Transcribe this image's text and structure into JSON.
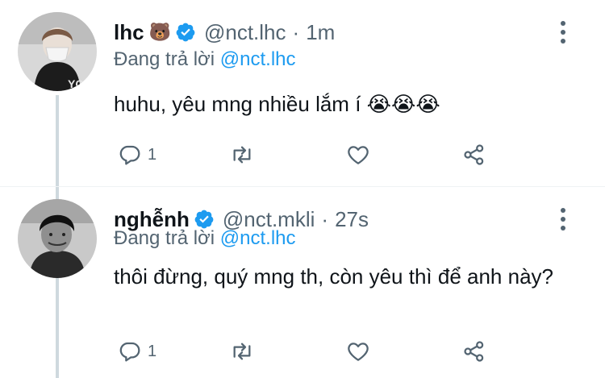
{
  "colors": {
    "link": "#1d9bf0",
    "muted": "#536471",
    "text": "#0f1419",
    "thread_line": "#cfd9de"
  },
  "tweets": [
    {
      "display_name": "lhc",
      "name_emoji": "🐻",
      "verified_icon": "verified-badge-icon",
      "handle": "@nct.lhc",
      "separator": "·",
      "time": "1m",
      "replying_prefix": "Đang trả lời",
      "replying_to": "@nct.lhc",
      "text": "huhu, yêu mng nhiều lắm í 😭😭😭",
      "reply_count": "1",
      "icons": [
        "reply-icon",
        "retweet-icon",
        "like-icon",
        "share-icon",
        "more-options-icon"
      ]
    },
    {
      "display_name": "nghễnh",
      "verified_icon": "verified-badge-icon",
      "handle": "@nct.mkli",
      "separator": "·",
      "time": "27s",
      "replying_prefix": "Đang trả lời",
      "replying_to": "@nct.lhc",
      "text": "thôi đừng, quý mng th, còn yêu thì để anh này?",
      "reply_count": "1",
      "icons": [
        "reply-icon",
        "retweet-icon",
        "like-icon",
        "share-icon",
        "more-options-icon"
      ]
    }
  ]
}
